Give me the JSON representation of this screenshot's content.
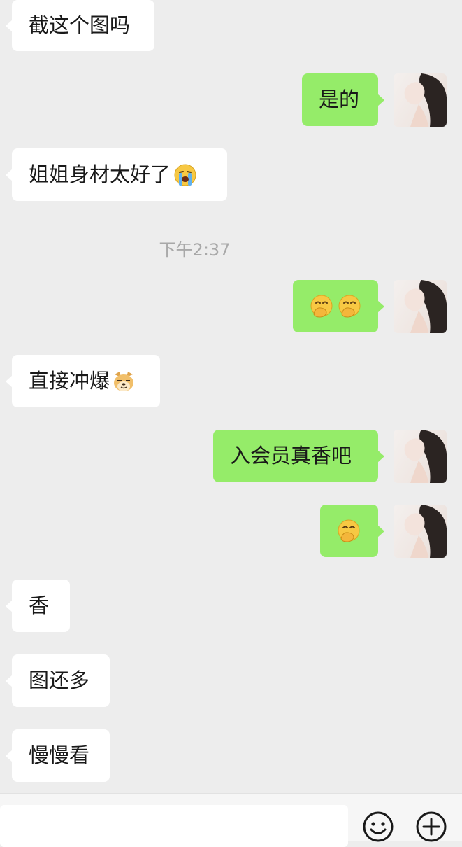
{
  "messages": [
    {
      "side": "left",
      "text": "截这个图吗"
    },
    {
      "side": "right",
      "text": "是的"
    },
    {
      "side": "left",
      "text": "姐姐身材太好了",
      "emoji": "loudly-crying-face-icon"
    },
    {
      "side": "right",
      "emoji": "face-with-hand-over-mouth-icon",
      "count": 2
    },
    {
      "side": "left",
      "text": "直接冲爆",
      "emoji": "doge-icon"
    },
    {
      "side": "right",
      "text": "入会员真香吧"
    },
    {
      "side": "right",
      "emoji": "face-with-hand-over-mouth-icon",
      "count": 1
    },
    {
      "side": "left",
      "text": "香"
    },
    {
      "side": "left",
      "text": "图还多"
    },
    {
      "side": "left",
      "text": "慢慢看"
    }
  ],
  "timestamp": "下午2:37",
  "input_bar": {
    "icons": [
      "smiley-icon",
      "plus-icon"
    ]
  },
  "colors": {
    "background": "#ededed",
    "incoming_bubble": "#ffffff",
    "outgoing_bubble": "#95ec69",
    "text": "#191919",
    "timestamp": "#a8a8a8"
  }
}
